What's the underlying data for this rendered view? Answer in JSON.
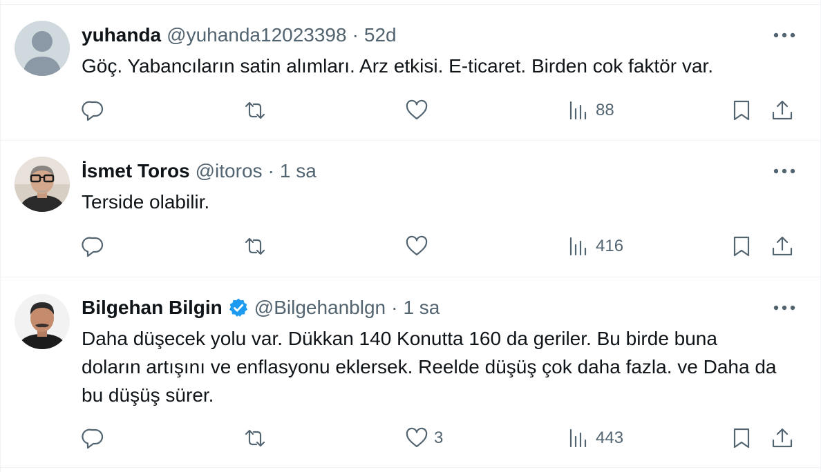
{
  "tweets": [
    {
      "name": "yuhanda",
      "verified": false,
      "handle": "@yuhanda12023398",
      "separator": "·",
      "time": "52d",
      "text": "Göç. Yabancıların satin alımları. Arz etkisi. E-ticaret. Birden cok faktör var.",
      "avatar": "default-avatar",
      "replies": "",
      "reposts": "",
      "likes": "",
      "views": "88"
    },
    {
      "name": "İsmet Toros",
      "verified": false,
      "handle": "@itoros",
      "separator": "·",
      "time": "1 sa",
      "text": "Terside olabilir.",
      "avatar": "photo-man-glasses",
      "replies": "",
      "reposts": "",
      "likes": "",
      "views": "416"
    },
    {
      "name": "Bilgehan Bilgin",
      "verified": true,
      "handle": "@Bilgehanblgn",
      "separator": "·",
      "time": "1 sa",
      "text": "Daha düşecek yolu var. Dükkan 140 Konutta 160 da geriler. Bu birde buna doların artışını ve enflasyonu eklersek. Reelde düşüş çok daha fazla. ve Daha da bu düşüş sürer.",
      "avatar": "photo-man-mustache",
      "replies": "",
      "reposts": "",
      "likes": "3",
      "views": "443"
    }
  ],
  "icons": {
    "reply": "reply-icon",
    "repost": "repost-icon",
    "like": "heart-icon",
    "views": "views-icon",
    "bookmark": "bookmark-icon",
    "share": "share-icon",
    "more": "more-icon",
    "verified": "verified-badge-icon"
  },
  "colors": {
    "text": "#0f1419",
    "secondary": "#536471",
    "divider": "#eff3f4",
    "verified": "#1d9bf0"
  }
}
